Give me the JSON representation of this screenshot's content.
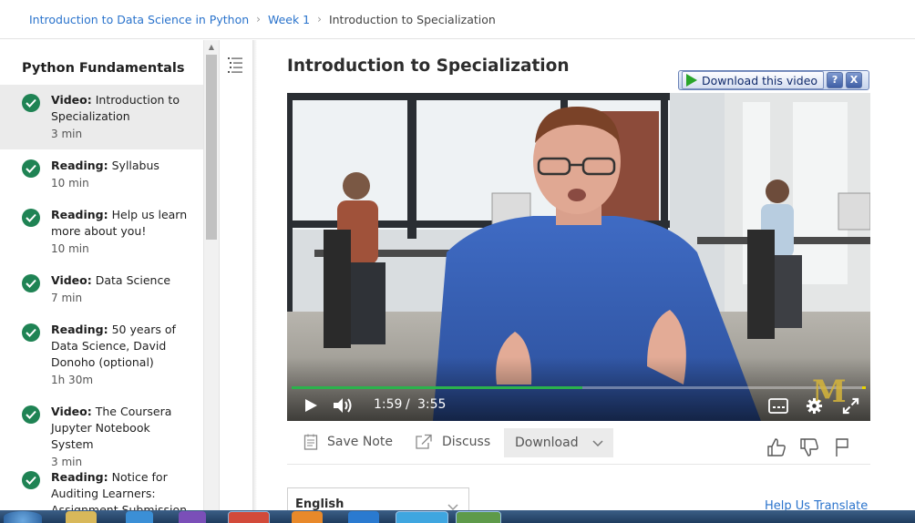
{
  "breadcrumb": {
    "course": "Introduction to Data Science in Python",
    "week": "Week 1",
    "current": "Introduction to Specialization"
  },
  "sidebar": {
    "title": "Python Fundamentals",
    "items": [
      {
        "type": "Video:",
        "title": "Introduction to Specialization",
        "duration": "3 min",
        "active": true
      },
      {
        "type": "Reading:",
        "title": "Syllabus",
        "duration": "10 min"
      },
      {
        "type": "Reading:",
        "title": "Help us learn more about you!",
        "duration": "10 min"
      },
      {
        "type": "Video:",
        "title": "Data Science",
        "duration": "7 min"
      },
      {
        "type": "Reading:",
        "title": "50 years of Data Science, David Donoho (optional)",
        "duration": "1h 30m"
      },
      {
        "type": "Video:",
        "title": "The Coursera Jupyter Notebook System",
        "duration": "3 min"
      },
      {
        "type": "Reading:",
        "title": "Notice for Auditing Learners: Assignment Submission",
        "duration": ""
      }
    ]
  },
  "main": {
    "title": "Introduction to Specialization"
  },
  "download_widget": {
    "label": "Download this video",
    "help": "?",
    "close": "X"
  },
  "player": {
    "current_time": "1:59",
    "separator": "/",
    "duration": "3:55",
    "progress": 0.506,
    "accent": "#2bb24c"
  },
  "actions": {
    "save_note": "Save Note",
    "discuss": "Discuss",
    "download": "Download"
  },
  "transcript": {
    "language": "English",
    "help_translate": "Help Us Translate"
  },
  "colors": {
    "link": "#2a73cc",
    "check": "#1f8354",
    "active_item_bg": "#ebebeb"
  }
}
